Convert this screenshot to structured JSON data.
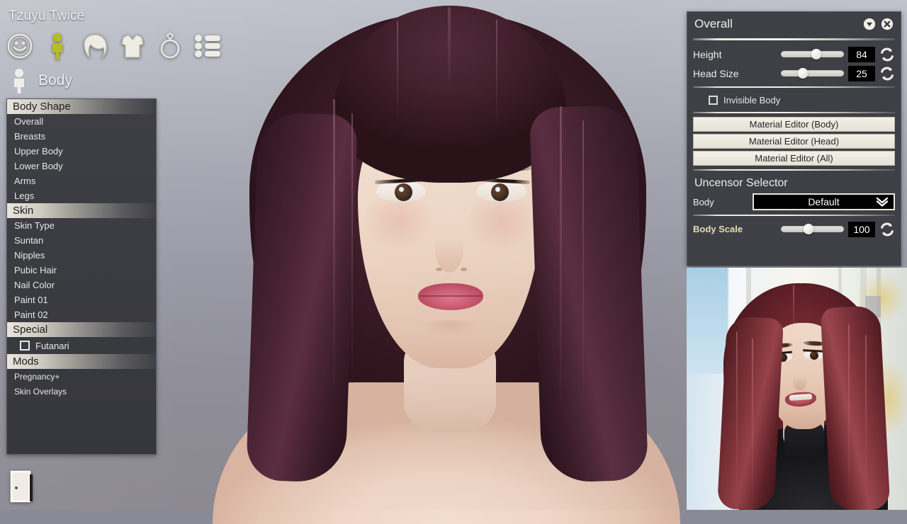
{
  "app": {
    "character_name": "Tzuyu Twice",
    "current_category": "Body"
  },
  "main_toolbar": [
    {
      "id": "face",
      "icon": "face-icon",
      "label": "Face",
      "active": false
    },
    {
      "id": "body",
      "icon": "body-icon",
      "label": "Body",
      "active": true
    },
    {
      "id": "hair",
      "icon": "hair-icon",
      "label": "Hair",
      "active": false
    },
    {
      "id": "clothes",
      "icon": "shirt-icon",
      "label": "Clothes",
      "active": false
    },
    {
      "id": "accessory",
      "icon": "ring-icon",
      "label": "Accessories",
      "active": false
    },
    {
      "id": "list",
      "icon": "list-icon",
      "label": "List",
      "active": false
    }
  ],
  "sidebar": {
    "sections": [
      {
        "header": "Body Shape",
        "items": [
          "Overall",
          "Breasts",
          "Upper Body",
          "Lower Body",
          "Arms",
          "Legs"
        ]
      },
      {
        "header": "Skin",
        "items": [
          "Skin Type",
          "Suntan",
          "Nipples",
          "Pubic Hair",
          "Nail Color",
          "Paint 01",
          "Paint 02"
        ]
      },
      {
        "header": "Special",
        "checkbox": {
          "label": "Futanari",
          "checked": false
        },
        "items": []
      },
      {
        "header": "Mods",
        "items": [
          "Pregnancy+",
          "Skin Overlays"
        ]
      }
    ]
  },
  "exit_button": {
    "icon": "door-icon",
    "label": "Exit"
  },
  "right_panel": {
    "title": "Overall",
    "controls": {
      "collapse_icon": "chevron-down-circle-icon",
      "close_icon": "close-circle-icon"
    },
    "sliders": [
      {
        "label": "Height",
        "value": "84",
        "percent": 56,
        "reset_icon": "reset-icon"
      },
      {
        "label": "Head Size",
        "value": "25",
        "percent": 35,
        "reset_icon": "reset-icon"
      }
    ],
    "invisible_body": {
      "label": "Invisible Body",
      "checked": false
    },
    "buttons": [
      "Material Editor (Body)",
      "Material Editor (Head)",
      "Material Editor (All)"
    ],
    "uncensor": {
      "title": "Uncensor Selector",
      "field_label": "Body",
      "selected": "Default",
      "caret_icon": "chevron-down-icon"
    },
    "body_scale": {
      "label": "Body Scale",
      "value": "100",
      "percent": 44,
      "reset_icon": "reset-icon",
      "label_color": "#e7dcb5"
    }
  },
  "reference_photo": {
    "name": "reference-photo",
    "description": "Photo of a woman with long reddish-brown hair wearing a black high-neck top"
  },
  "colors": {
    "panel_bg": "#3f4045",
    "panel_border": "#55565b",
    "header_gradient_light": "#e9e6dd",
    "text_light": "#ededee",
    "accent_label": "#e7dcb5",
    "value_box_bg": "#000000",
    "button_face": "#f3f0e7",
    "active_toolbar_icon": "#b5be1e",
    "viewport_top": "#c3c6cd",
    "viewport_bottom": "#8b8890",
    "hair_color": "#4a2434",
    "ref_hair_color": "#7e3339"
  }
}
